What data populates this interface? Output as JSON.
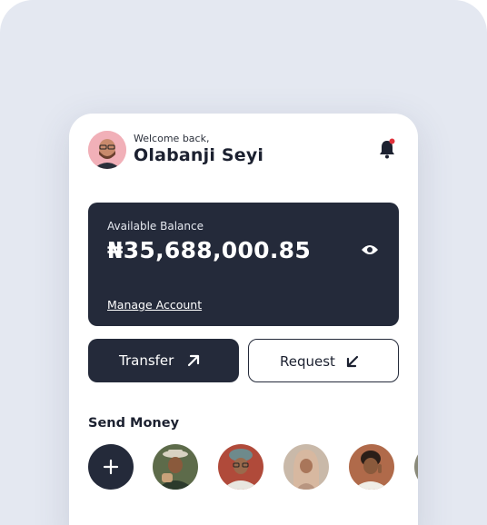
{
  "header": {
    "welcome_text": "Welcome back,",
    "user_name": "Olabanji Seyi"
  },
  "balance": {
    "label": "Available Balance",
    "amount": "₦35,688,000.85",
    "manage_link": "Manage Account"
  },
  "actions": {
    "transfer_label": "Transfer",
    "request_label": "Request"
  },
  "send_money": {
    "title": "Send Money",
    "contacts_count_visible": 6
  },
  "colors": {
    "background": "#e4e8f1",
    "card": "#242a3a",
    "notification_dot": "#e0323c",
    "accent_text": "#1c2130"
  }
}
